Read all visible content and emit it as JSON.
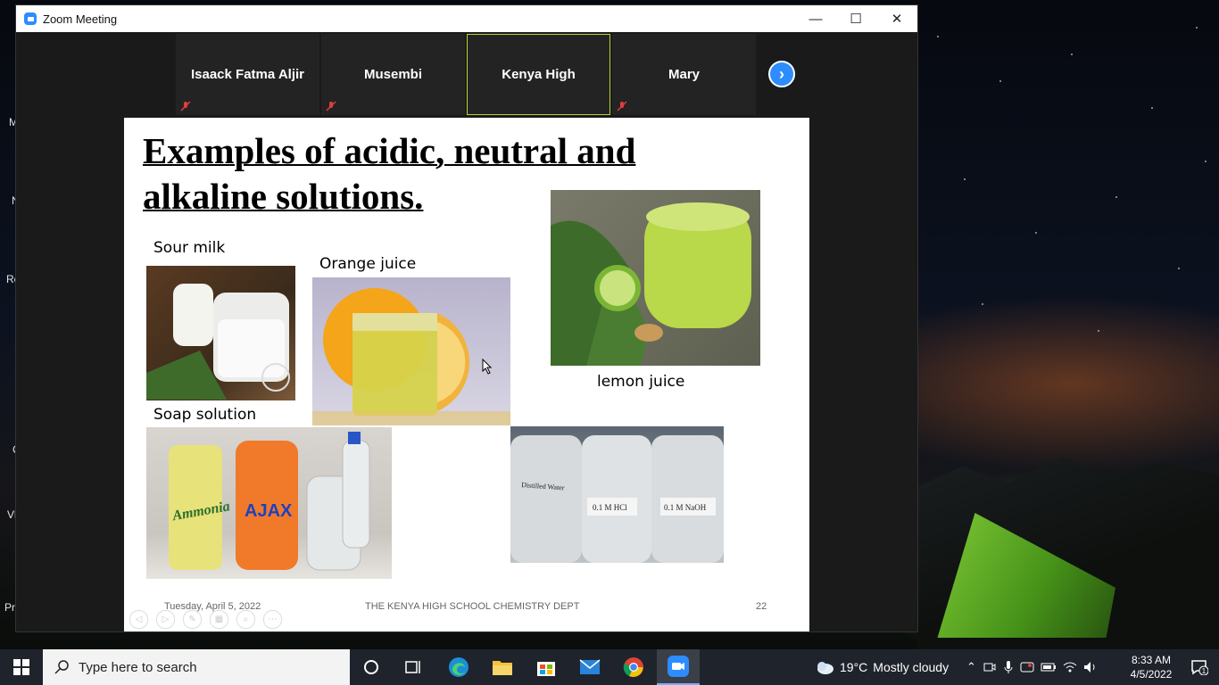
{
  "window": {
    "title": "Zoom Meeting",
    "controls": {
      "minimize": "—",
      "maximize": "☐",
      "close": "✕"
    }
  },
  "gallery": {
    "participants": [
      {
        "name": "Isaack Fatma Aljir",
        "muted": true,
        "active": false
      },
      {
        "name": "Musembi",
        "muted": true,
        "active": false
      },
      {
        "name": "Kenya High",
        "muted": false,
        "active": true
      },
      {
        "name": "Mary",
        "muted": true,
        "active": false
      }
    ],
    "next_icon": "›"
  },
  "slide": {
    "title_line1": "Examples of acidic, neutral and",
    "title_line2": "alkaline solutions.",
    "captions": {
      "sour_milk": "Sour milk",
      "orange_juice": "Orange juice",
      "lemon_juice": "lemon juice",
      "soap_solution": "Soap solution"
    },
    "bottle_labels": {
      "water": "Distilled Water",
      "hcl": "0.1 M HCl",
      "naoh": "0.1 M NaOH"
    },
    "soap_labels": {
      "ammonia": "Ammonia",
      "ajax": "AJAX"
    },
    "footer": {
      "date": "Tuesday, April 5, 2022",
      "dept": "THE KENYA HIGH SCHOOL CHEMISTRY DEPT",
      "page": "22"
    }
  },
  "desktop": {
    "icon_labels": [
      "M",
      "N",
      "Re",
      "C",
      "Vl",
      "Pr"
    ]
  },
  "taskbar": {
    "search_placeholder": "Type here to search",
    "weather_temp": "19°C",
    "weather_desc": "Mostly cloudy",
    "time": "8:33 AM",
    "date": "4/5/2022",
    "notification_count": "1"
  },
  "colors": {
    "zoom_blue": "#2d8cff",
    "active_speaker_border": "#b8d23a",
    "taskbar_bg": "#1f232b"
  }
}
